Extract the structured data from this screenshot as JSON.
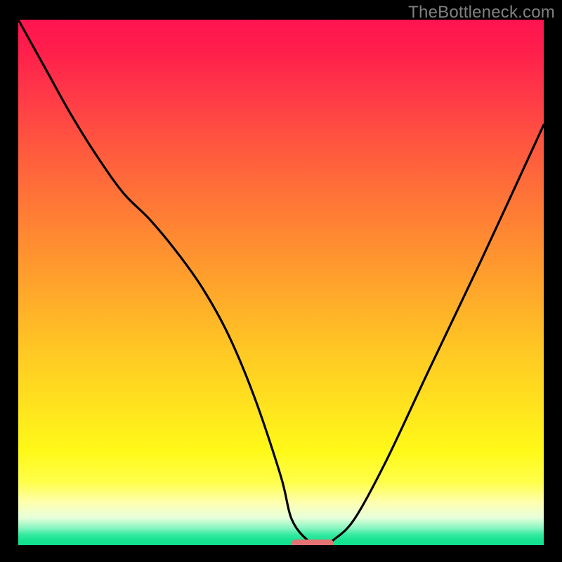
{
  "watermark": "TheBottleneck.com",
  "colors": {
    "frame": "#000000",
    "watermark": "#808080",
    "curve": "#000000",
    "marker": "#e57373"
  },
  "chart_data": {
    "type": "line",
    "title": "",
    "xlabel": "",
    "ylabel": "",
    "xlim": [
      0,
      100
    ],
    "ylim": [
      0,
      100
    ],
    "grid": false,
    "legend": false,
    "series": [
      {
        "name": "bottleneck-curve",
        "x": [
          0,
          5,
          10,
          15,
          20,
          25,
          30,
          35,
          40,
          45,
          50,
          52,
          55,
          58,
          60,
          64,
          70,
          78,
          88,
          100
        ],
        "y": [
          100,
          91,
          82,
          74,
          67,
          62,
          56,
          49,
          40,
          28,
          13,
          5,
          1,
          0,
          1,
          5,
          16,
          33,
          54,
          80
        ]
      }
    ],
    "optimal_marker": {
      "x_start": 52,
      "x_end": 60,
      "y": 0
    },
    "background_gradient_stops": [
      {
        "pos": 0.0,
        "color": "#ff1450"
      },
      {
        "pos": 0.5,
        "color": "#ffa22c"
      },
      {
        "pos": 0.82,
        "color": "#fff918"
      },
      {
        "pos": 0.95,
        "color": "#e6ffda"
      },
      {
        "pos": 1.0,
        "color": "#0fe08e"
      }
    ]
  }
}
